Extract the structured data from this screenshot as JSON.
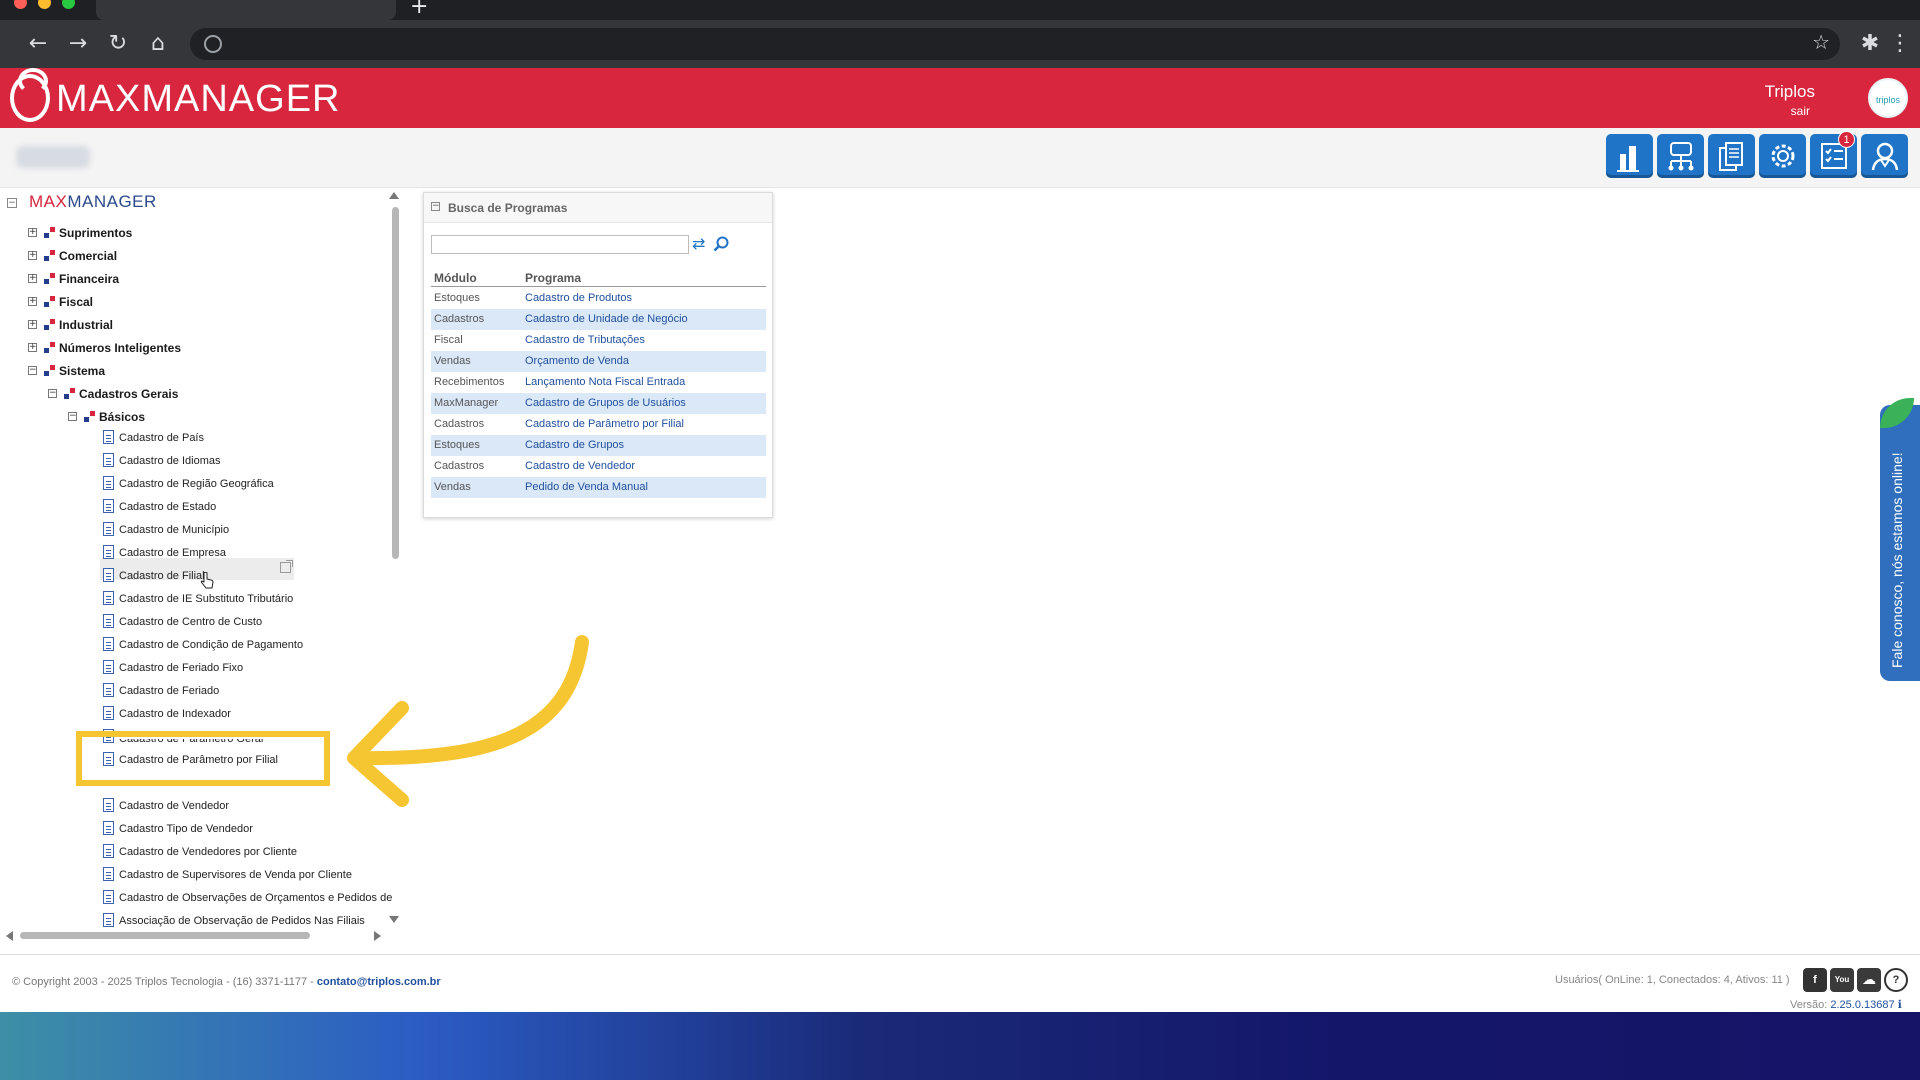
{
  "app": {
    "logo": "MAXMANAGER",
    "user_name": "Triplos",
    "user_exit": "sair",
    "avatar_label": "triplos"
  },
  "toolbar": {
    "notification_count": "1",
    "tools": [
      "reports-icon",
      "network-icon",
      "documents-icon",
      "settings-icon",
      "tasks-icon",
      "user-support-icon"
    ]
  },
  "tree": {
    "root_left": "MAX",
    "root_right": "MANAGER",
    "modules": [
      {
        "label": "Suprimentos",
        "toggle": "+"
      },
      {
        "label": "Comercial",
        "toggle": "+"
      },
      {
        "label": "Financeira",
        "toggle": "+"
      },
      {
        "label": "Fiscal",
        "toggle": "+"
      },
      {
        "label": "Industrial",
        "toggle": "+"
      },
      {
        "label": "Números Inteligentes",
        "toggle": "+"
      },
      {
        "label": "Sistema",
        "toggle": "−"
      }
    ],
    "group": {
      "label": "Cadastros Gerais",
      "toggle": "−"
    },
    "subgroup": {
      "label": "Básicos",
      "toggle": "−"
    },
    "programs": [
      "Cadastro de País",
      "Cadastro de Idiomas",
      "Cadastro de Região Geográfica",
      "Cadastro de Estado",
      "Cadastro de Município",
      "Cadastro de Empresa",
      "Cadastro de Filial",
      "Cadastro de IE Substituto Tributário",
      "Cadastro de Centro de Custo",
      "Cadastro de Condição de Pagamento",
      "Cadastro de Feriado Fixo",
      "Cadastro de Feriado",
      "Cadastro de Indexador",
      "Cadastro de Parâmetro Geral",
      "Cadastro de Parâmetro por Filial",
      "",
      "Cadastro de Vendedor",
      "Cadastro Tipo de Vendedor",
      "Cadastro de Vendedores por Cliente",
      "Cadastro de Supervisores de Venda por Cliente",
      "Cadastro de Observações de Orçamentos e Pedidos de",
      "Associação de Observação de Pedidos Nas Filiais"
    ]
  },
  "search_panel": {
    "title": "Busca de Programas",
    "search_value": "",
    "col_module": "Módulo",
    "col_program": "Programa",
    "rows": [
      {
        "module": "Estoques",
        "program": "Cadastro de Produtos"
      },
      {
        "module": "Cadastros",
        "program": "Cadastro de Unidade de Negócio"
      },
      {
        "module": "Fiscal",
        "program": "Cadastro de Tributações"
      },
      {
        "module": "Vendas",
        "program": "Orçamento de Venda"
      },
      {
        "module": "Recebimentos",
        "program": "Lançamento Nota Fiscal Entrada"
      },
      {
        "module": "MaxManager",
        "program": "Cadastro de Grupos de Usuários"
      },
      {
        "module": "Cadastros",
        "program": "Cadastro de Parâmetro por Filial"
      },
      {
        "module": "Estoques",
        "program": "Cadastro de Grupos"
      },
      {
        "module": "Cadastros",
        "program": "Cadastro de Vendedor"
      },
      {
        "module": "Vendas",
        "program": "Pedido de Venda Manual"
      }
    ]
  },
  "chat": {
    "label": "Fale conosco, nós estamos online!"
  },
  "footer": {
    "copyright": "© Copyright 2003 - 2025 Triplos Tecnologia - (16) 3371-1177 - ",
    "email": "contato@triplos.com.br",
    "users": "Usuários( OnLine: 1, Conectados: 4, Ativos: 11 )",
    "version_label": "Versão:",
    "version_value": "2.25.0.13687",
    "social": [
      "f",
      "You",
      "☁",
      "?"
    ]
  },
  "colors": {
    "brand_red": "#d7263d",
    "tool_blue": "#1f74c7",
    "highlight_yellow": "#f6c632"
  }
}
